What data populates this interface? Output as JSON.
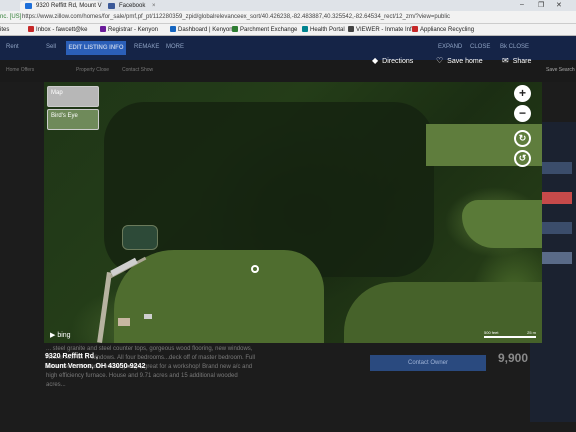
{
  "browser": {
    "tabs": [
      {
        "title": "9320 Reffitt Rd, Mount V",
        "close": "×",
        "color": "#1e6fd9"
      },
      {
        "title": "Facebook",
        "close": "×",
        "color": "#3b5998"
      }
    ],
    "window_controls": {
      "minimize": "–",
      "restore": "❐",
      "close": "✕"
    },
    "url_secure_label": "nc. [US]",
    "url": "https://www.zillow.com/homes/for_sale/pmf,pf_pt/112280359_zpid/globalrelevanceex_sort/40.426238,-82.483887,40.325542,-82.64534_rect/12_zm/?view=public",
    "bookmarks": [
      {
        "label": "ites",
        "color": "#555"
      },
      {
        "label": "Inbox - fawcett@ke",
        "color": "#c62828"
      },
      {
        "label": "Registrar - Kenyon",
        "color": "#6a1b9a"
      },
      {
        "label": "Dashboard | Kenyon",
        "color": "#1565c0"
      },
      {
        "label": "Parchment Exchange",
        "color": "#2e7d32"
      },
      {
        "label": "Health Portal",
        "color": "#00838f"
      },
      {
        "label": "VIEWER - Inmate Inf",
        "color": "#444"
      },
      {
        "label": "Appliance Recycling",
        "color": "#c62828"
      }
    ]
  },
  "site": {
    "nav_items": [
      "Rent",
      "Sell"
    ],
    "list_button": "EDIT LISTING INFO",
    "nav_right": [
      "REMAKE",
      "MORE"
    ],
    "nav_far": [
      "EXPAND",
      "CLOSE",
      "Bk CLOSE"
    ],
    "sub_items": [
      "Home Offers",
      "Property Close",
      "Contact Show"
    ],
    "save_search": "Save Search"
  },
  "map": {
    "actions": {
      "directions": "Directions",
      "save": "Save home",
      "share": "Share"
    },
    "map_type_label": "Map",
    "birds_eye_label": "Bird's Eye",
    "zoom_in": "+",
    "zoom_out": "−",
    "rotate_cw": "↻",
    "rotate_ccw": "↺",
    "provider": "bing",
    "scale_labels": [
      "500 feet",
      "25 m"
    ]
  },
  "listing": {
    "address_line1": "9320 Reffitt Rd ,",
    "address_line2": "Mount Vernon, OH 43050-9242",
    "description": "... steel granite and steel counter tops, gorgeous wood flooring, new windows, Newer roof all in windows. All four bedrooms...deck off of master bedroom. Full Basement with under house garage, great for a workshop! Brand new a/c and high efficiency furnace. House and 9.71 acres and 15 additional wooded acres...",
    "contact_button": "Contact Owner",
    "price_partial": "9,900"
  }
}
